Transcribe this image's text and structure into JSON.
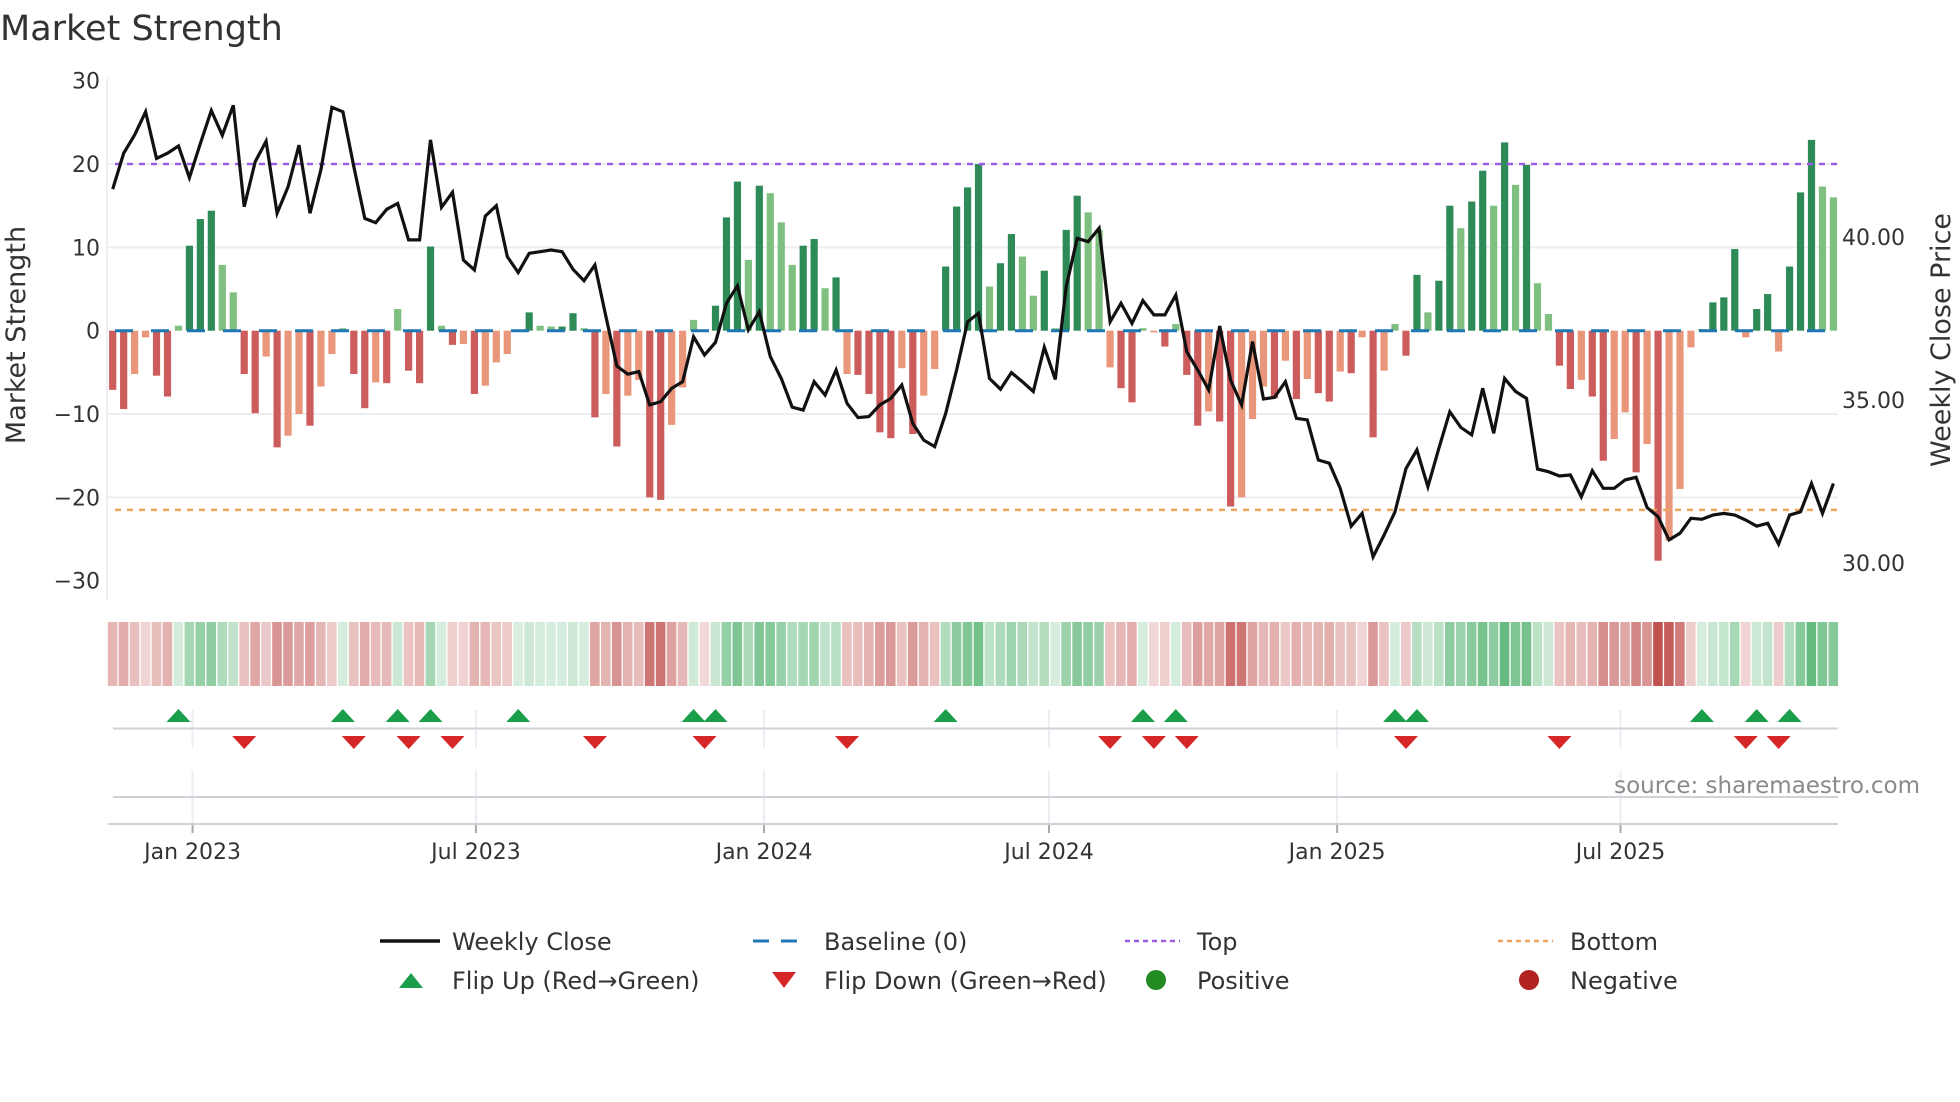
{
  "chart_data": {
    "type": "bar",
    "title": "Market Strength",
    "ylabel": "Market Strength",
    "y2label": "Weekly Close Price",
    "ylim": [
      -30,
      30
    ],
    "y2lim": [
      28.93,
      44.77
    ],
    "yticks": [
      30,
      20,
      10,
      0,
      -10,
      -20,
      -30
    ],
    "yticklabels": [
      "30",
      "20",
      "10",
      "0",
      "−10",
      "−20",
      "−30"
    ],
    "y2ticks": [
      40,
      35,
      30
    ],
    "y2ticklabels": [
      "40.00",
      "35.00",
      "30.00"
    ],
    "grid": true,
    "start_date": "2022-11-11",
    "frequency": "weekly",
    "xticks": [
      {
        "date": "2023-01-01",
        "label": "Jan 2023"
      },
      {
        "date": "2023-07-01",
        "label": "Jul 2023"
      },
      {
        "date": "2024-01-01",
        "label": "Jan 2024"
      },
      {
        "date": "2024-07-01",
        "label": "Jul 2024"
      },
      {
        "date": "2025-01-01",
        "label": "Jan 2025"
      },
      {
        "date": "2025-07-01",
        "label": "Jul 2025"
      }
    ],
    "thresholds": {
      "top": 20,
      "bottom": -21.5,
      "baseline": 0
    },
    "strength": [
      -7.1,
      -9.4,
      -5.2,
      -0.8,
      -5.4,
      -7.9,
      0.6,
      10.2,
      13.4,
      14.4,
      7.9,
      4.6,
      -5.2,
      -9.9,
      -3.1,
      -14,
      -12.6,
      -10,
      -11.4,
      -6.7,
      -2.8,
      0.3,
      -5.2,
      -9.3,
      -6.2,
      -6.3,
      2.6,
      -4.8,
      -6.3,
      10.1,
      0.6,
      -1.7,
      -1.6,
      -7.6,
      -6.6,
      -3.8,
      -2.8,
      0.1,
      2.2,
      0.6,
      0.5,
      0.5,
      2.1,
      0.3,
      -10.4,
      -7.6,
      -13.9,
      -7.8,
      -5.9,
      -20,
      -20.3,
      -11.3,
      -6.8,
      1.3,
      -0.1,
      3,
      13.6,
      17.9,
      8.5,
      17.4,
      16.5,
      13,
      7.9,
      10.2,
      11,
      5.1,
      6.4,
      -5.2,
      -5.3,
      -7.6,
      -12.2,
      -12.9,
      -4.5,
      -12.4,
      -7.8,
      -4.6,
      7.7,
      14.9,
      17.2,
      20,
      5.3,
      8.1,
      11.6,
      8.9,
      4.2,
      7.2,
      0.3,
      12.1,
      16.2,
      14.2,
      12.1,
      -4.4,
      -6.9,
      -8.6,
      0.3,
      -0.2,
      -1.9,
      0.8,
      -5.3,
      -11.4,
      -9.7,
      -10.9,
      -21.1,
      -20,
      -10.6,
      -6.7,
      -8.1,
      -3.6,
      -8.2,
      -5.8,
      -7.5,
      -8.5,
      -4.9,
      -5.1,
      -0.8,
      -12.8,
      -4.8,
      0.8,
      -3,
      6.7,
      2.2,
      6,
      15,
      12.3,
      15.5,
      19.2,
      15,
      22.6,
      17.5,
      19.9,
      5.7,
      2,
      -4.2,
      -7,
      -5.9,
      -7.9,
      -15.6,
      -13,
      -9.8,
      -17,
      -13.6,
      -27.6,
      -25.2,
      -19,
      -2,
      0.2,
      3.4,
      4,
      9.8,
      -0.8,
      2.6,
      4.4,
      -2.5,
      7.7,
      16.6,
      22.9,
      17.3,
      16
    ],
    "weekly_close": [
      41.47,
      42.57,
      43.13,
      43.84,
      42.41,
      42.57,
      42.79,
      41.82,
      42.87,
      43.88,
      43.12,
      44.04,
      40.93,
      42.31,
      42.94,
      40.73,
      41.54,
      42.82,
      40.73,
      42.06,
      43.98,
      43.84,
      42.16,
      40.57,
      40.44,
      40.85,
      41.03,
      39.91,
      39.91,
      42.98,
      40.91,
      41.37,
      39.29,
      38.99,
      40.64,
      40.96,
      39.4,
      38.91,
      39.5,
      39.55,
      39.6,
      39.55,
      39.01,
      38.66,
      39.14,
      37.56,
      36.04,
      35.79,
      35.87,
      34.85,
      34.95,
      35.36,
      35.56,
      36.94,
      36.38,
      36.77,
      37.97,
      38.5,
      37.15,
      37.71,
      36.33,
      35.66,
      34.78,
      34.69,
      35.56,
      35.15,
      35.92,
      34.9,
      34.46,
      34.49,
      34.85,
      35.05,
      35.46,
      34.28,
      33.77,
      33.57,
      34.59,
      35.92,
      37.4,
      37.66,
      35.66,
      35.33,
      35.84,
      35.56,
      35.26,
      36.62,
      35.63,
      38.48,
      39.96,
      39.86,
      40.27,
      37.4,
      37.97,
      37.35,
      38.05,
      37.61,
      37.61,
      38.22,
      36.48,
      35.92,
      35.31,
      37.27,
      35.61,
      34.85,
      36.79,
      35.03,
      35.08,
      35.56,
      34.44,
      34.39,
      33.16,
      33.06,
      32.29,
      31.13,
      31.52,
      30.19,
      30.86,
      31.57,
      32.9,
      33.47,
      32.34,
      33.52,
      34.64,
      34.16,
      33.93,
      35.36,
      33.98,
      35.66,
      35.26,
      35.05,
      32.88,
      32.8,
      32.67,
      32.7,
      32.03,
      32.83,
      32.29,
      32.29,
      32.55,
      32.63,
      31.7,
      31.42,
      30.71,
      30.91,
      31.37,
      31.34,
      31.47,
      31.52,
      31.47,
      31.32,
      31.13,
      31.22,
      30.58,
      31.47,
      31.57,
      32.44,
      31.52,
      32.44
    ],
    "flip_up_weeks": [
      6,
      21,
      26,
      29,
      37,
      53,
      55,
      76,
      94,
      97,
      117,
      119,
      145,
      150,
      153
    ],
    "flip_down_weeks": [
      12,
      22,
      27,
      31,
      44,
      54,
      67,
      91,
      95,
      98,
      118,
      132,
      149,
      152
    ],
    "legend": {
      "placement": "bottom",
      "items": [
        {
          "key": "close",
          "label": "Weekly Close"
        },
        {
          "key": "baseline",
          "label": "Baseline (0)"
        },
        {
          "key": "top",
          "label": "Top"
        },
        {
          "key": "bottom",
          "label": "Bottom"
        },
        {
          "key": "flip_up",
          "label": "Flip Up (Red→Green)"
        },
        {
          "key": "flip_down",
          "label": "Flip Down (Green→Red)"
        },
        {
          "key": "positive",
          "label": "Positive"
        },
        {
          "key": "negative",
          "label": "Negative"
        }
      ]
    }
  },
  "source": "source: sharemaestro.com",
  "colors": {
    "pos_strong": "#2e8b57",
    "pos_weak": "#7fbf7f",
    "neg_strong": "#cd5c5c",
    "neg_weak": "#e9967a",
    "close": "#111111",
    "baseline": "#1f77b4",
    "top": "#9b5de5",
    "bottom": "#f0a35e",
    "flip_up": "#1a9e4a",
    "flip_down": "#d62728",
    "positive": "#228b22",
    "negative": "#b22222",
    "grid": "#eceef3"
  }
}
